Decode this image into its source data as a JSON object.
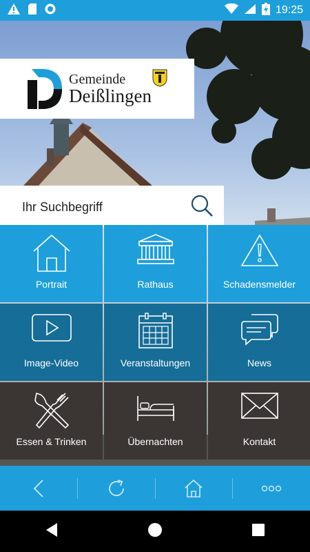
{
  "status_bar": {
    "time": "19:25",
    "icons": [
      "warning-icon",
      "sd-card-icon",
      "sync-icon",
      "wifi-icon",
      "signal-icon",
      "battery-charging-icon"
    ]
  },
  "logo": {
    "line1": "Gemeinde",
    "line2": "Deißlingen"
  },
  "search": {
    "placeholder": "Ihr Suchbegriff"
  },
  "tiles": [
    {
      "label": "Portrait",
      "icon": "house-icon"
    },
    {
      "label": "Rathaus",
      "icon": "townhall-icon"
    },
    {
      "label": "Schadensmelder",
      "icon": "warning-triangle-icon"
    },
    {
      "label": "Image-Video",
      "icon": "play-video-icon"
    },
    {
      "label": "Veranstaltungen",
      "icon": "calendar-icon"
    },
    {
      "label": "News",
      "icon": "chat-bubbles-icon"
    },
    {
      "label": "Essen & Trinken",
      "icon": "fork-knife-icon"
    },
    {
      "label": "Übernachten",
      "icon": "bed-icon"
    },
    {
      "label": "Kontakt",
      "icon": "envelope-icon"
    }
  ],
  "bottom_bar": [
    "back-icon",
    "reload-icon",
    "home-icon",
    "more-icon"
  ],
  "colors": {
    "primary": "#1e9fdc",
    "dark_blue": "#166d97",
    "dark_brown": "#3b3633"
  }
}
